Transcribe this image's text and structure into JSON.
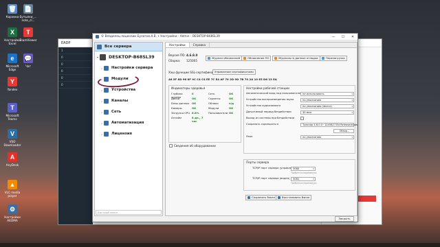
{
  "desktop_icons": [
    {
      "label": "Корзина",
      "glyph": "🗑",
      "color": "#5b8cc8"
    },
    {
      "label": "Бутылки_...\nnote_cl...",
      "glyph": "📄",
      "color": "#6d7f92"
    },
    {
      "label": "Настройки\nExcel",
      "glyph": "X",
      "color": "#1d6f42"
    },
    {
      "label": "TeamViewer",
      "glyph": "T",
      "color": "#e53935"
    },
    {
      "label": "Microsoft\nEdge",
      "glyph": "e",
      "color": "#1a73c8"
    },
    {
      "label": "Чат",
      "glyph": "💬",
      "color": "#6a5acd"
    },
    {
      "label": "Yandex",
      "glyph": "Y",
      "color": "#e53935"
    },
    {
      "label": "Microsoft\nTeams",
      "glyph": "T",
      "color": "#5b5fc7"
    },
    {
      "label": "VSO\nDownloader",
      "glyph": "V",
      "color": "#2e6da4"
    },
    {
      "label": "AnyDesk",
      "glyph": "A",
      "color": "#e5302a"
    },
    {
      "label": "VLC media\nplayer",
      "glyph": "▲",
      "color": "#f08a00"
    },
    {
      "label": "Настройки\nAltOMA",
      "glyph": "⚙",
      "color": "#3a6ea5"
    }
  ],
  "bg_window": {
    "title": "EADP",
    "rows": [
      "1",
      "0",
      "0",
      "0",
      "0",
      "0"
    ]
  },
  "window": {
    "title": "© Владелец лицензии Булатов А.В. • Настройки - Admin - DESKTOP-B68SL39",
    "controls": [
      "—",
      "☐",
      "✕"
    ]
  },
  "tree": {
    "all_servers": "Все сервера",
    "host": "DESKTOP-B68SL39",
    "nodes": [
      {
        "label": "Настройки сервера",
        "color": "#3a6ea5"
      },
      {
        "label": "Модули",
        "color": "#3a6ea5"
      },
      {
        "label": "Устройства",
        "color": "#3a6ea5"
      },
      {
        "label": "Каналы",
        "color": "#3a6ea5"
      },
      {
        "label": "Сеть",
        "color": "#3a6ea5"
      },
      {
        "label": "Автоматизация",
        "color": "#3a6ea5"
      },
      {
        "label": "Лицензия",
        "color": "#3a6ea5"
      }
    ],
    "filter_placeholder": "Быстрый поиск"
  },
  "tabs": [
    "Настройки",
    "Справка"
  ],
  "version": {
    "version_label": "Версия ПО:",
    "version_value": "4.6.8.0",
    "build_label": "Сборка:",
    "build_value": "125005"
  },
  "toolbar": {
    "journal": "Журнал обновлений",
    "update": "Обновление ПО",
    "journals_debug": "Журналы & данные отладки",
    "restart": "Перезагрузка"
  },
  "ssl": {
    "label": "Хэш функции SSL-сертификата",
    "button": "Управление сертификатами",
    "hash": "46 5F 8D 96 8F 9C C4 C4 EE 7C E4 AF 70 2D 9D 7B 70 2A 10 E5 D6 13 EA"
  },
  "health": {
    "title": "Индикаторы здоровья",
    "rows": [
      {
        "l1": "Глубина архива",
        "v1": "0",
        "l2": "Сеть",
        "v2": "OK"
      },
      {
        "l1": "Диски",
        "v1": "OK",
        "l2": "Скрипты",
        "v2": "OK"
      },
      {
        "l1": "Базы данных",
        "v1": "OK",
        "l2": "Облако",
        "v2": "н/д"
      },
      {
        "l1": "Камеры",
        "v1": "OK",
        "l2": "Модули",
        "v2": "OK"
      },
      {
        "l1": "Загрузка CPU",
        "v1": "8.8%",
        "l2": "Пользователи",
        "v2": "OK"
      },
      {
        "l1": "Аптайм",
        "v1": "8 дн., 7 час",
        "l2": "",
        "v2": ""
      }
    ],
    "hw_button": "Сведения об оборудовании"
  },
  "workstation": {
    "title": "Настройки рабочей станции",
    "rows": [
      {
        "label": "Автоматический вход под пользователем",
        "value": "не использовать"
      },
      {
        "label": "Устройство воспроизведения звука",
        "value": "по умолчанию"
      },
      {
        "label": "Устройство аудиозахвата",
        "value": "по умолчанию (device)"
      },
      {
        "label": "Допустимый период бездействия",
        "value": "30 мин"
      },
      {
        "label": "Выход из системы при бездействии",
        "value": ""
      },
      {
        "label": "Сохранять скриншоты в",
        "value": "Трассир 4.6.0.0~1245827-B4 Release/shots"
      },
      {
        "label": "",
        "value": "Обзор..."
      },
      {
        "label": "Язык",
        "value": "по умолчанию"
      }
    ]
  },
  "ports": {
    "title": "Порты сервера",
    "rows": [
      {
        "label": "TCP/IP порт сервера (управление)",
        "value": "3080",
        "hint": "Требуется перезапуск"
      },
      {
        "label": "TCP/IP порт сервера (видео)",
        "value": "3081",
        "hint": "Требуется перезапуск"
      }
    ],
    "save_button": "Сохранить бэкап",
    "restore_button": "Восстановить бэкап"
  },
  "close_button": "Закрыть"
}
